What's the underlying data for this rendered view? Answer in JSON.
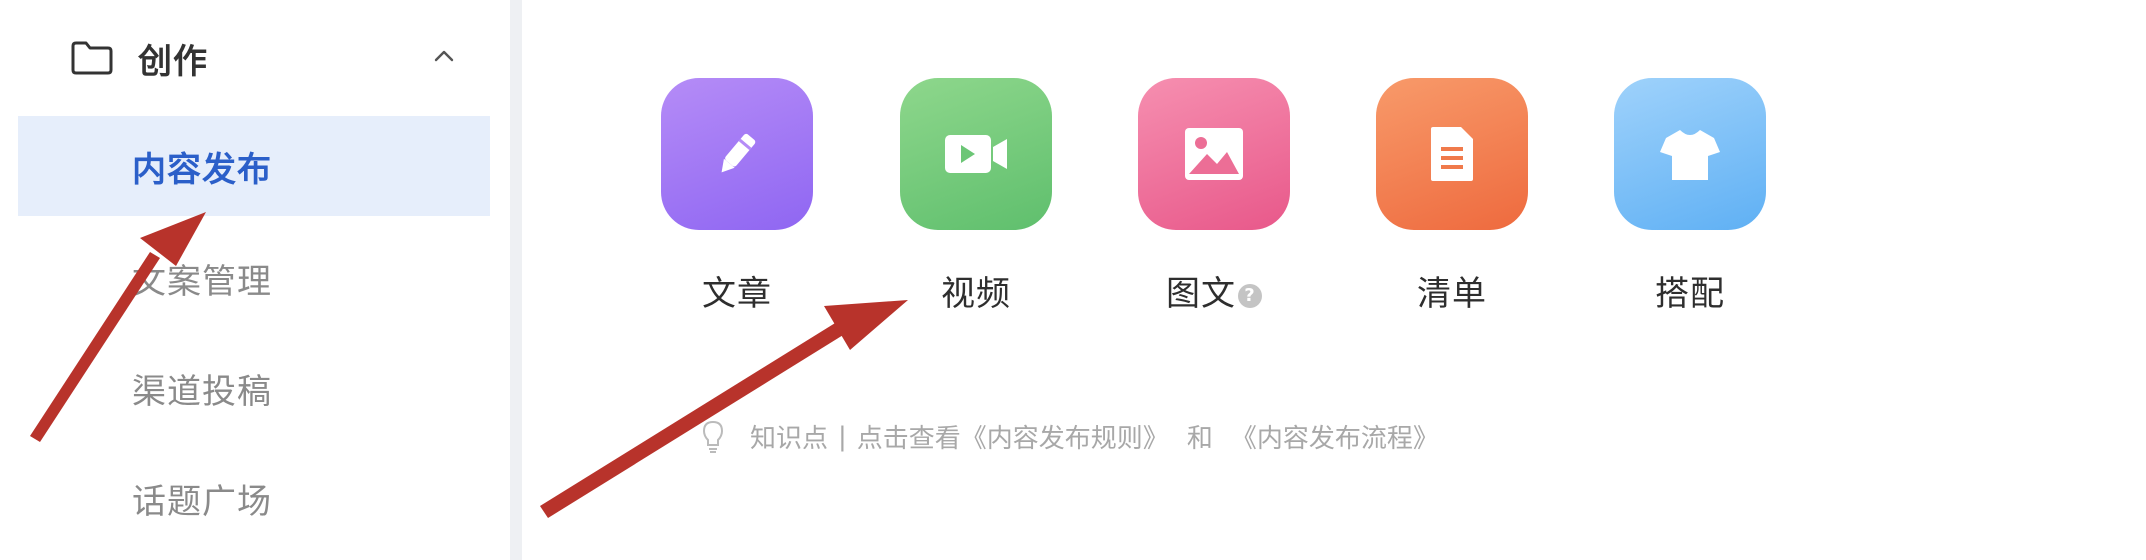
{
  "sidebar": {
    "group_title": "创作",
    "items": [
      {
        "label": "内容发布",
        "active": true
      },
      {
        "label": "文案管理",
        "active": false
      },
      {
        "label": "渠道投稿",
        "active": false
      },
      {
        "label": "话题广场",
        "active": false
      }
    ]
  },
  "main": {
    "tiles": [
      {
        "label": "文章",
        "icon": "pen-icon"
      },
      {
        "label": "视频",
        "icon": "video-icon"
      },
      {
        "label": "图文",
        "icon": "image-icon",
        "help": "?"
      },
      {
        "label": "清单",
        "icon": "list-icon"
      },
      {
        "label": "搭配",
        "icon": "shirt-icon"
      }
    ],
    "tip": {
      "prefix": "知识点",
      "separator": "|",
      "text": "点击查看",
      "link1": "《内容发布规则》",
      "and": "和",
      "link2": "《内容发布流程》"
    }
  },
  "colors": {
    "active_bg": "#e6eefb",
    "active_text": "#2b5fc9",
    "annotation_arrow": "#c0392b"
  }
}
